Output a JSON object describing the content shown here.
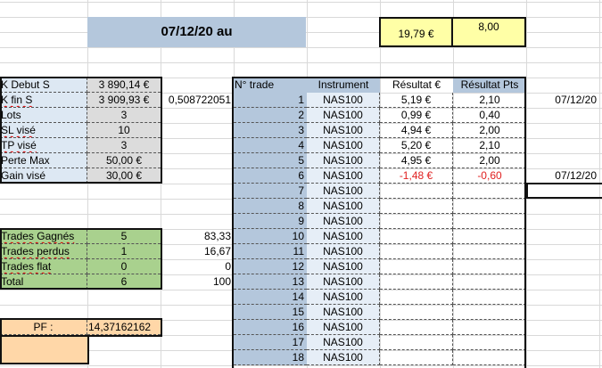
{
  "header": {
    "title": "07/12/20 au",
    "gain_eur": "19,79 €",
    "gain_pts": "8,00"
  },
  "summary": [
    {
      "label": "K Debut S",
      "value": "3 890,14 €",
      "extra": ""
    },
    {
      "label": "K fin S",
      "value": "3 909,93 €",
      "extra": "0,508722051"
    },
    {
      "label": "Lots",
      "value": "3",
      "extra": ""
    },
    {
      "label": "SL visé",
      "value": "10",
      "extra": ""
    },
    {
      "label": "TP visé",
      "value": "3",
      "extra": ""
    },
    {
      "label": "Perte Max",
      "value": "50,00 €",
      "extra": ""
    },
    {
      "label": "Gain visé",
      "value": "30,00 €",
      "extra": ""
    }
  ],
  "stats": [
    {
      "label": "Trades Gagnés",
      "value": "5",
      "pct": "83,33"
    },
    {
      "label": "Trades perdus",
      "value": "1",
      "pct": "16,67"
    },
    {
      "label": "Trades flat",
      "value": "0",
      "pct": "0"
    },
    {
      "label": "Total",
      "value": "6",
      "pct": "100"
    }
  ],
  "pf": {
    "label": "PF :",
    "value": "14,37162162"
  },
  "trades_header": {
    "num": "N° trade",
    "instrument": "Instrument",
    "result_eur": "Résultat €",
    "result_pts": "Résultat Pts"
  },
  "trades": [
    {
      "num": "1",
      "instrument": "NAS100",
      "eur": "5,19 €",
      "pts": "2,10",
      "date": "07/12/20"
    },
    {
      "num": "2",
      "instrument": "NAS100",
      "eur": "0,99 €",
      "pts": "0,40",
      "date": ""
    },
    {
      "num": "3",
      "instrument": "NAS100",
      "eur": "4,94 €",
      "pts": "2,00",
      "date": ""
    },
    {
      "num": "4",
      "instrument": "NAS100",
      "eur": "5,20 €",
      "pts": "2,10",
      "date": ""
    },
    {
      "num": "5",
      "instrument": "NAS100",
      "eur": "4,95 €",
      "pts": "2,00",
      "date": ""
    },
    {
      "num": "6",
      "instrument": "NAS100",
      "eur": "-1,48 €",
      "pts": "-0,60",
      "date": "07/12/20"
    },
    {
      "num": "7",
      "instrument": "NAS100",
      "eur": "",
      "pts": "",
      "date": ""
    },
    {
      "num": "8",
      "instrument": "NAS100",
      "eur": "",
      "pts": "",
      "date": ""
    },
    {
      "num": "9",
      "instrument": "NAS100",
      "eur": "",
      "pts": "",
      "date": ""
    },
    {
      "num": "10",
      "instrument": "NAS100",
      "eur": "",
      "pts": "",
      "date": ""
    },
    {
      "num": "11",
      "instrument": "NAS100",
      "eur": "",
      "pts": "",
      "date": ""
    },
    {
      "num": "12",
      "instrument": "NAS100",
      "eur": "",
      "pts": "",
      "date": ""
    },
    {
      "num": "13",
      "instrument": "NAS100",
      "eur": "",
      "pts": "",
      "date": ""
    },
    {
      "num": "14",
      "instrument": "NAS100",
      "eur": "",
      "pts": "",
      "date": ""
    },
    {
      "num": "15",
      "instrument": "NAS100",
      "eur": "",
      "pts": "",
      "date": ""
    },
    {
      "num": "16",
      "instrument": "NAS100",
      "eur": "",
      "pts": "",
      "date": ""
    },
    {
      "num": "17",
      "instrument": "NAS100",
      "eur": "",
      "pts": "",
      "date": ""
    },
    {
      "num": "18",
      "instrument": "NAS100",
      "eur": "",
      "pts": "",
      "date": ""
    }
  ],
  "colors": {
    "negative": "#e02020",
    "header_blue": "#b4c7dc",
    "green": "#a9d18e",
    "orange": "#ffd7a8",
    "yellow": "#ffffa6"
  }
}
